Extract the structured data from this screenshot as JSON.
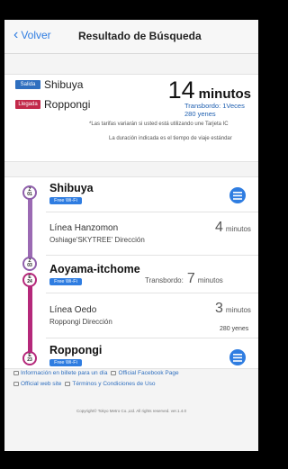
{
  "nav": {
    "back_label": "Volver",
    "title": "Resultado de Búsqueda"
  },
  "summary": {
    "departure_tag": "Salida",
    "departure_station": "Shibuya",
    "arrival_tag": "Llegada",
    "arrival_station": "Roppongi",
    "total_minutes": "14",
    "minutes_unit": "minutos",
    "transfers": "Transbordo: 1Veces",
    "fare": "280 yenes",
    "note_fares": "*Las tarifas variarán si usted está utilizando une Tarjeta IC",
    "note_duration": "La duración indicada es el tiempo de viaje estándar"
  },
  "route": {
    "stations": [
      {
        "name": "Shibuya",
        "code": "Z 01",
        "wifi": "Free Wi-Fi"
      },
      {
        "name": "Aoyama-itchome",
        "code_top": "Z 03",
        "code_bottom": "E 24",
        "wifi": "Free Wi-Fi"
      },
      {
        "name": "Roppongi",
        "code": "E 23",
        "wifi": "Free Wi-Fi"
      }
    ],
    "segments": [
      {
        "line": "Línea Hanzomon",
        "direction": "Oshiage'SKYTREE' Dirección",
        "minutes": "4",
        "unit": "minutos"
      },
      {
        "line": "Línea Oedo",
        "direction": "Roppongi Dirección",
        "minutes": "3",
        "unit": "minutos",
        "fare": "280 yenes"
      }
    ],
    "transfer": {
      "label": "Transbordo:",
      "minutes": "7",
      "unit": "minutos"
    }
  },
  "footer": {
    "link_ticket": "Información en billete para un día",
    "link_facebook": "Official Facebook Page",
    "link_web": "Official web site",
    "link_terms": "Términos y Condiciones de Uso",
    "copyright": "Copyright© Tokyo Metro Co.,Ltd. All rights reserved. ver.1.4.0"
  },
  "colors": {
    "accent": "#2f7de1",
    "hanzomon": "#9b6ab3",
    "oedo": "#b5287a",
    "arrival": "#c2294a"
  }
}
